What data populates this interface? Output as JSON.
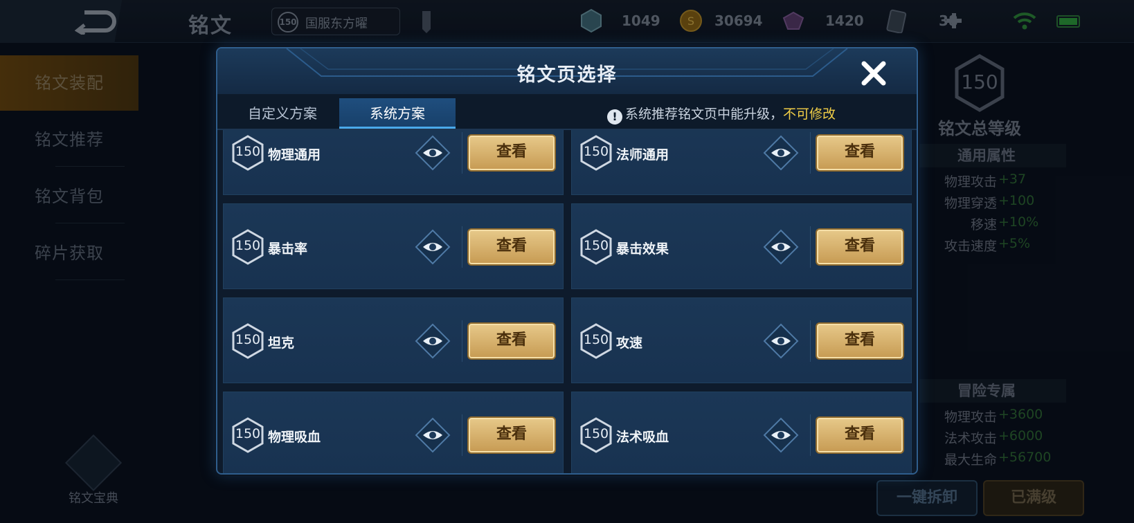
{
  "topbar": {
    "title": "铭文",
    "server_level": "150",
    "server_name": "国服东方曜",
    "resources": [
      {
        "icon": "diamond-gem-icon",
        "value": "1049"
      },
      {
        "icon": "gold-coin-icon",
        "value": "30694"
      },
      {
        "icon": "crystal-icon",
        "value": "1420"
      },
      {
        "icon": "ticket-card-icon",
        "value": "38"
      }
    ]
  },
  "sidebar": {
    "items": [
      {
        "label": "铭文装配",
        "active": true
      },
      {
        "label": "铭文推荐",
        "active": false
      },
      {
        "label": "铭文背包",
        "active": false
      },
      {
        "label": "碎片获取",
        "active": false
      }
    ],
    "codex_label": "铭文宝典"
  },
  "right_panel": {
    "total_level": "150",
    "total_title": "铭文总等级",
    "general_head": "通用属性",
    "general_stats": [
      {
        "name": "物理攻击",
        "value": "+37"
      },
      {
        "name": "物理穿透",
        "value": "+100"
      },
      {
        "name": "移速",
        "value": "+10%"
      },
      {
        "name": "攻击速度",
        "value": "+5%"
      }
    ],
    "adventure_head": "冒险专属",
    "adventure_stats": [
      {
        "name": "物理攻击",
        "value": "+3600"
      },
      {
        "name": "法术攻击",
        "value": "+6000"
      },
      {
        "name": "最大生命",
        "value": "+56700"
      }
    ],
    "unload_label": "一键拆卸",
    "maxed_label": "已满级"
  },
  "modal": {
    "title": "铭文页选择",
    "tabs": [
      {
        "label": "自定义方案",
        "active": false
      },
      {
        "label": "系统方案",
        "active": true
      }
    ],
    "notice_text": "系统推荐铭文页中能升级，",
    "notice_highlight": "不可修改",
    "view_label": "查看",
    "pages": [
      {
        "level": "150",
        "name": "物理通用"
      },
      {
        "level": "150",
        "name": "法师通用"
      },
      {
        "level": "150",
        "name": "暴击率"
      },
      {
        "level": "150",
        "name": "暴击效果"
      },
      {
        "level": "150",
        "name": "坦克"
      },
      {
        "level": "150",
        "name": "攻速"
      },
      {
        "level": "150",
        "name": "物理吸血"
      },
      {
        "level": "150",
        "name": "法术吸血"
      }
    ]
  },
  "colors": {
    "accent_gold": "#e7c98a",
    "tab_active": "#1f4e7e",
    "notice_highlight": "#f2cf47",
    "stat_green": "#2f6a36"
  }
}
